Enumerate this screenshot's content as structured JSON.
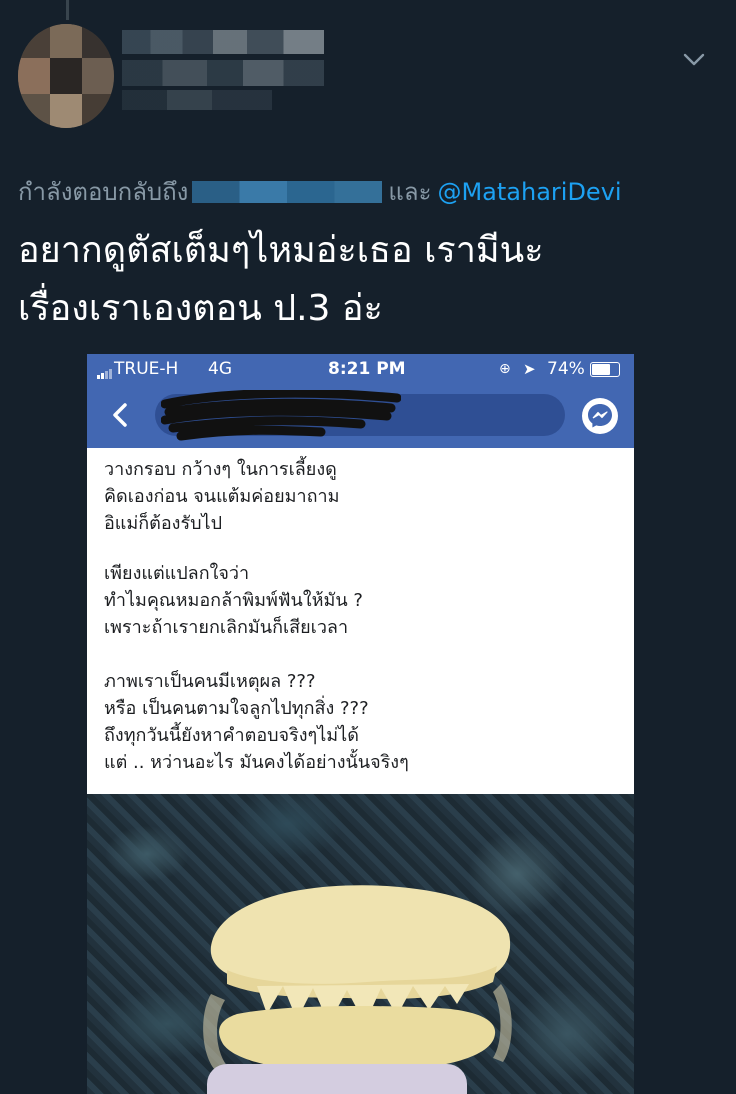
{
  "tweet": {
    "reply_prefix": "กำลังตอบกลับถึง",
    "reply_and": "และ",
    "reply_mention": "@MatahariDevi",
    "text_lines": [
      "อยากดูตัสเต็มๆไหมอ่ะเธอ เรามีนะ",
      "เรื่องเราเองตอน ป.3 อ่ะ"
    ]
  },
  "embedded_screenshot": {
    "status_bar": {
      "carrier": "TRUE-H",
      "network": "4G",
      "time": "8:21 PM",
      "battery": "74%"
    },
    "post_lines": [
      "วางกรอบ กว้างๆ ในการเลี้ยงดู",
      "คิดเองก่อน จนแต้มค่อยมาถาม",
      "อิแม่ก็ต้องรับไป",
      "",
      "เพียงแต่แปลกใจว่า",
      "ทำไมคุณหมอกล้าพิมพ์ฟันให้มัน ?",
      "เพราะถ้าเรายกเลิกมันก็เสียเวลา",
      "",
      "ภาพเราเป็นคนมีเหตุผล ???",
      "หรือ เป็นคนตามใจลูกไปทุกสิ่ง ???",
      "ถึงทุกวันนี้ยังหาคำตอบจริงๆไม่ได้",
      "แต่ .. หว่านอะไร มันคงได้อย่างนั้นจริงๆ"
    ]
  },
  "icons": {
    "menu": "chevron-down-icon",
    "back": "back-arrow-icon",
    "messenger": "messenger-icon"
  },
  "colors": {
    "background": "#15202b",
    "mention": "#1da1f2",
    "muted": "#8899a6",
    "facebook_blue": "#4267b2"
  }
}
